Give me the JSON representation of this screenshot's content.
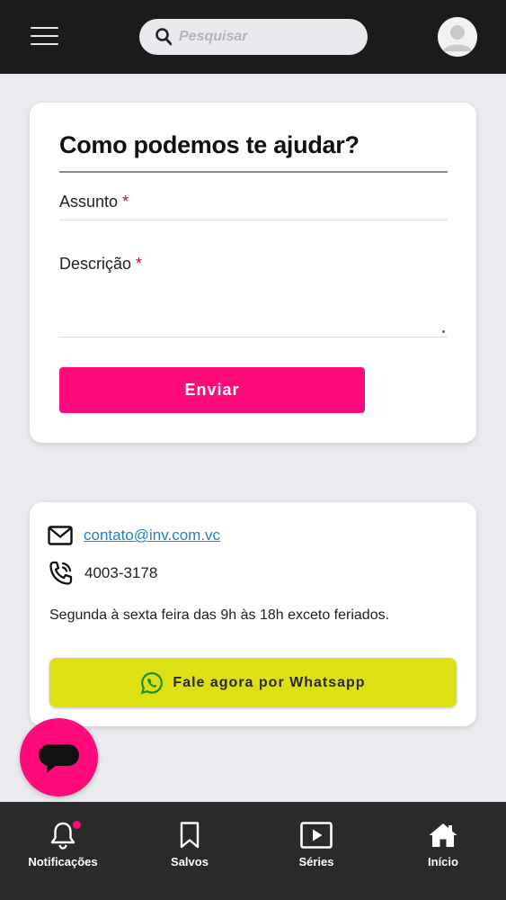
{
  "header": {
    "search_placeholder": "Pesquisar"
  },
  "help_form": {
    "title": "Como podemos te ajudar?",
    "subject_label": "Assunto",
    "description_label": "Descrição",
    "required_marker": "*",
    "subject_value": "",
    "description_value": "",
    "submit_label": "Enviar"
  },
  "contact": {
    "email": "contato@inv.com.vc",
    "phone": "4003-3178",
    "hours": "Segunda à sexta feira das 9h às 18h exceto feriados.",
    "whatsapp_label": "Fale agora por Whatsapp"
  },
  "bottom_nav": {
    "items": [
      {
        "label": "Notificações",
        "icon": "bell-icon"
      },
      {
        "label": "Salvos",
        "icon": "bookmark-icon"
      },
      {
        "label": "Séries",
        "icon": "play-icon"
      },
      {
        "label": "Início",
        "icon": "home-icon"
      }
    ]
  },
  "colors": {
    "accent": "#ff0a7a",
    "whatsapp_button": "#dde012",
    "topbar": "#1b1b1b",
    "bottombar": "#2a2a2a",
    "link": "#1a86c8"
  }
}
